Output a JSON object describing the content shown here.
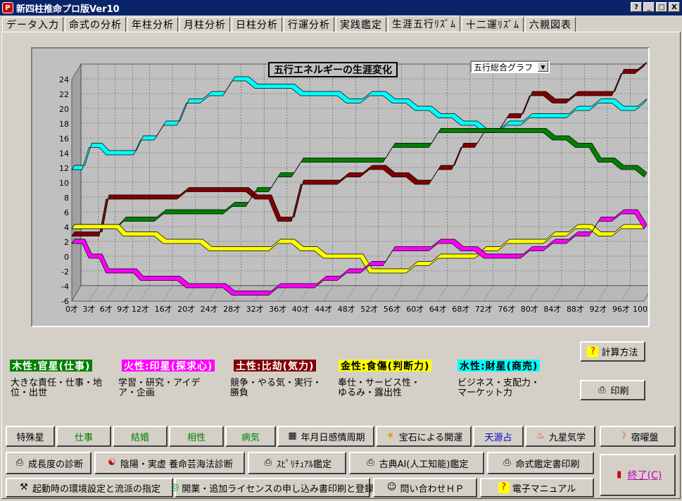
{
  "window": {
    "title": "新四柱推命プロ版Ver10",
    "help": "?",
    "minimize": "_",
    "maximize": "□",
    "close": "X"
  },
  "tabs": [
    "データ入力",
    "命式の分析",
    "年柱分析",
    "月柱分析",
    "日柱分析",
    "行運分析",
    "実践鑑定",
    "生涯五行ﾘｽﾞﾑ",
    "十二運ﾘｽﾞﾑ",
    "六親図表"
  ],
  "active_tab": 7,
  "chart_title": "五行エネルギーの生涯変化",
  "dropdown": {
    "value": "五行総合グラフ",
    "arrow": "▼"
  },
  "chart_data": {
    "type": "line",
    "x": [
      0,
      3,
      6,
      9,
      12,
      16,
      20,
      24,
      28,
      32,
      36,
      40,
      44,
      48,
      52,
      56,
      60,
      64,
      68,
      72,
      76,
      80,
      84,
      88,
      92,
      96,
      100
    ],
    "x_tick_labels": [
      "0才",
      "3才",
      "6才",
      "9才",
      "12才",
      "16才",
      "20才",
      "24才",
      "28才",
      "32才",
      "36才",
      "40才",
      "44才",
      "48才",
      "52才",
      "56才",
      "60才",
      "64才",
      "68才",
      "72才",
      "76才",
      "80才",
      "84才",
      "88才",
      "92才",
      "96才",
      "100才"
    ],
    "y_tick_labels": [
      "24",
      "22",
      "20",
      "18",
      "16",
      "14",
      "12",
      "10",
      "8",
      "6",
      "4",
      "2",
      "0",
      "-2",
      "-4",
      "-6"
    ],
    "ylim": [
      -6,
      24
    ],
    "grid": true,
    "series": [
      {
        "name": "木性:官星(仕事)",
        "color": "#008000",
        "values": [
          4,
          4,
          4,
          5,
          5,
          6,
          6,
          6,
          7,
          9,
          11,
          13,
          13,
          13,
          13,
          15,
          15,
          17,
          17,
          17,
          17,
          17,
          16,
          15,
          13,
          12,
          11
        ]
      },
      {
        "name": "火性:印星(探求心)",
        "color": "#ff00ff",
        "values": [
          2,
          0,
          -2,
          -2,
          -3,
          -3,
          -4,
          -4,
          -5,
          -5,
          -4,
          -4,
          -3,
          -2,
          -1,
          1,
          1,
          2,
          1,
          0,
          0,
          1,
          2,
          3,
          5,
          6,
          4
        ]
      },
      {
        "name": "土性:比劫(気力)",
        "color": "#800000",
        "values": [
          3,
          3,
          8,
          8,
          8,
          8,
          9,
          9,
          9,
          8,
          5,
          10,
          10,
          11,
          12,
          11,
          10,
          12,
          15,
          17,
          19,
          22,
          21,
          22,
          22,
          25,
          26
        ]
      },
      {
        "name": "金性:食傷(判断力)",
        "color": "#ffff00",
        "values": [
          4,
          4,
          4,
          3,
          3,
          2,
          2,
          1,
          1,
          1,
          2,
          1,
          0,
          0,
          -2,
          -2,
          -1,
          0,
          0,
          1,
          2,
          2,
          3,
          4,
          3,
          4,
          4
        ]
      },
      {
        "name": "水性:財星(商売)",
        "color": "#00ffff",
        "values": [
          12,
          15,
          14,
          14,
          16,
          18,
          21,
          22,
          24,
          23,
          23,
          22,
          22,
          21,
          22,
          21,
          20,
          19,
          18,
          17,
          18,
          19,
          19,
          20,
          21,
          20,
          21
        ]
      }
    ]
  },
  "legend": [
    {
      "label": "木性:官星(仕事)",
      "desc": "大きな責任・仕事・地位・出世",
      "bg": "#008000",
      "fg": "#ffffff"
    },
    {
      "label": "火性:印星(探求心)",
      "desc": "学習・研究・アイデア・企画",
      "bg": "#ff00ff",
      "fg": "#ffffff"
    },
    {
      "label": "土性:比劫(気力)",
      "desc": "競争・やる気・実行・勝負",
      "bg": "#800000",
      "fg": "#ffffff"
    },
    {
      "label": "金性:食傷(判断力)",
      "desc": "奉仕・サービス性・ゆるみ・露出性",
      "bg": "#ffff00",
      "fg": "#000000"
    },
    {
      "label": "水性:財星(商売)",
      "desc": "ビジネス・支配力・マーケット力",
      "bg": "#00ffff",
      "fg": "#000000"
    }
  ],
  "side_buttons": {
    "calc": "計算方法",
    "print": "印刷"
  },
  "row1": [
    "特殊星",
    "仕事",
    "結婚",
    "相性",
    "病気",
    "年月日感情周期",
    "宝石による開運",
    "天源占",
    "九星気学",
    "宿曜盤"
  ],
  "row2": [
    "成長度の診断",
    "陰陽・実虚 養命芸海法診断",
    "ｽﾋﾟﾘﾁｭｱﾙ鑑定",
    "古典AI(人工知能)鑑定",
    "命式鑑定書印刷"
  ],
  "row3": [
    "起動時の環境設定と流派の指定",
    "開業・追加ライセンスの申し込み書印刷と登録",
    "問い合わせＨＰ",
    "電子マニュアル"
  ],
  "exit": "終了(C)"
}
